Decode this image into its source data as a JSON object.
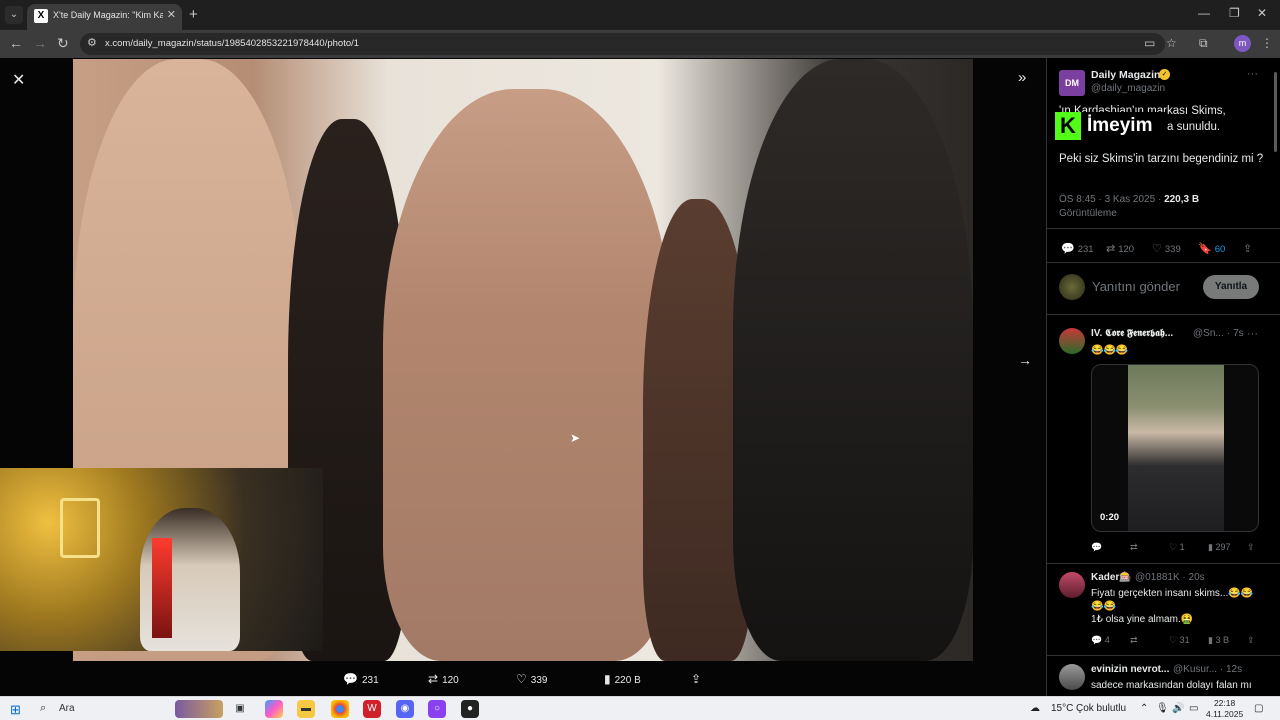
{
  "browser": {
    "tab_title": "X'te Daily Magazin: \"Kim Kardas",
    "tab_favicon": "X",
    "url": "x.com/daily_magazin/status/1985402853221978440/photo/1",
    "profile_initial": "m"
  },
  "viewer": {
    "actions": {
      "replies": "231",
      "retweets": "120",
      "likes": "339",
      "views": "220 B"
    }
  },
  "tweet": {
    "author_name": "Daily Magazin",
    "author_handle": "@daily_magazin",
    "avatar_text": "DM",
    "text_line1": "'ın Kardashian'ın markası Skims,",
    "text_line2": "a sunuldu.",
    "text_line3": "Peki siz Skims'in tarzını begendiniz mi ?",
    "time": "ÖS 8:45 · 3 Kas 2025 · ",
    "views_count": "220,3 B",
    "views_label": "Görüntüleme",
    "stats": {
      "replies": "231",
      "retweets": "120",
      "likes": "339",
      "bookmarks": "60"
    },
    "reply_placeholder": "Yanıtını gönder",
    "reply_button": "Yanıtla"
  },
  "overlay": {
    "k_letter": "K",
    "text": "İmeyim"
  },
  "replies": [
    {
      "name": "IV. 𝕮𝖔𝖗𝖊 𝕱𝖊𝖓𝖊𝖗𝖇𝖆𝖍...",
      "handle": "@Sn...",
      "time": "· 7s",
      "text": "😂😂😂",
      "video_time": "0:20",
      "likes": "1",
      "views": "297"
    },
    {
      "name": "Kader🎰",
      "handle": "@01881K · 20s",
      "text_line1": "Fiyatı gerçekten insanı skims...😂😂",
      "text_line2": "😂😂",
      "text_line3": "1₺ olsa yine almam.🤮",
      "replies": "4",
      "likes": "31",
      "views": "3 B"
    },
    {
      "name": "evinizin nevrot...",
      "handle": "@Kusur... · 12s",
      "text": "sadece markasından dolayı falan mı"
    }
  ],
  "taskbar": {
    "search_label": "Ara",
    "weather": "15°C",
    "weather_text": "Çok bulutlu",
    "time": "22:18",
    "date": "4.11.2025"
  },
  "colors": {
    "x_blue": "#1d9bf0",
    "kick_green": "#53fc18",
    "background": "#000000"
  }
}
